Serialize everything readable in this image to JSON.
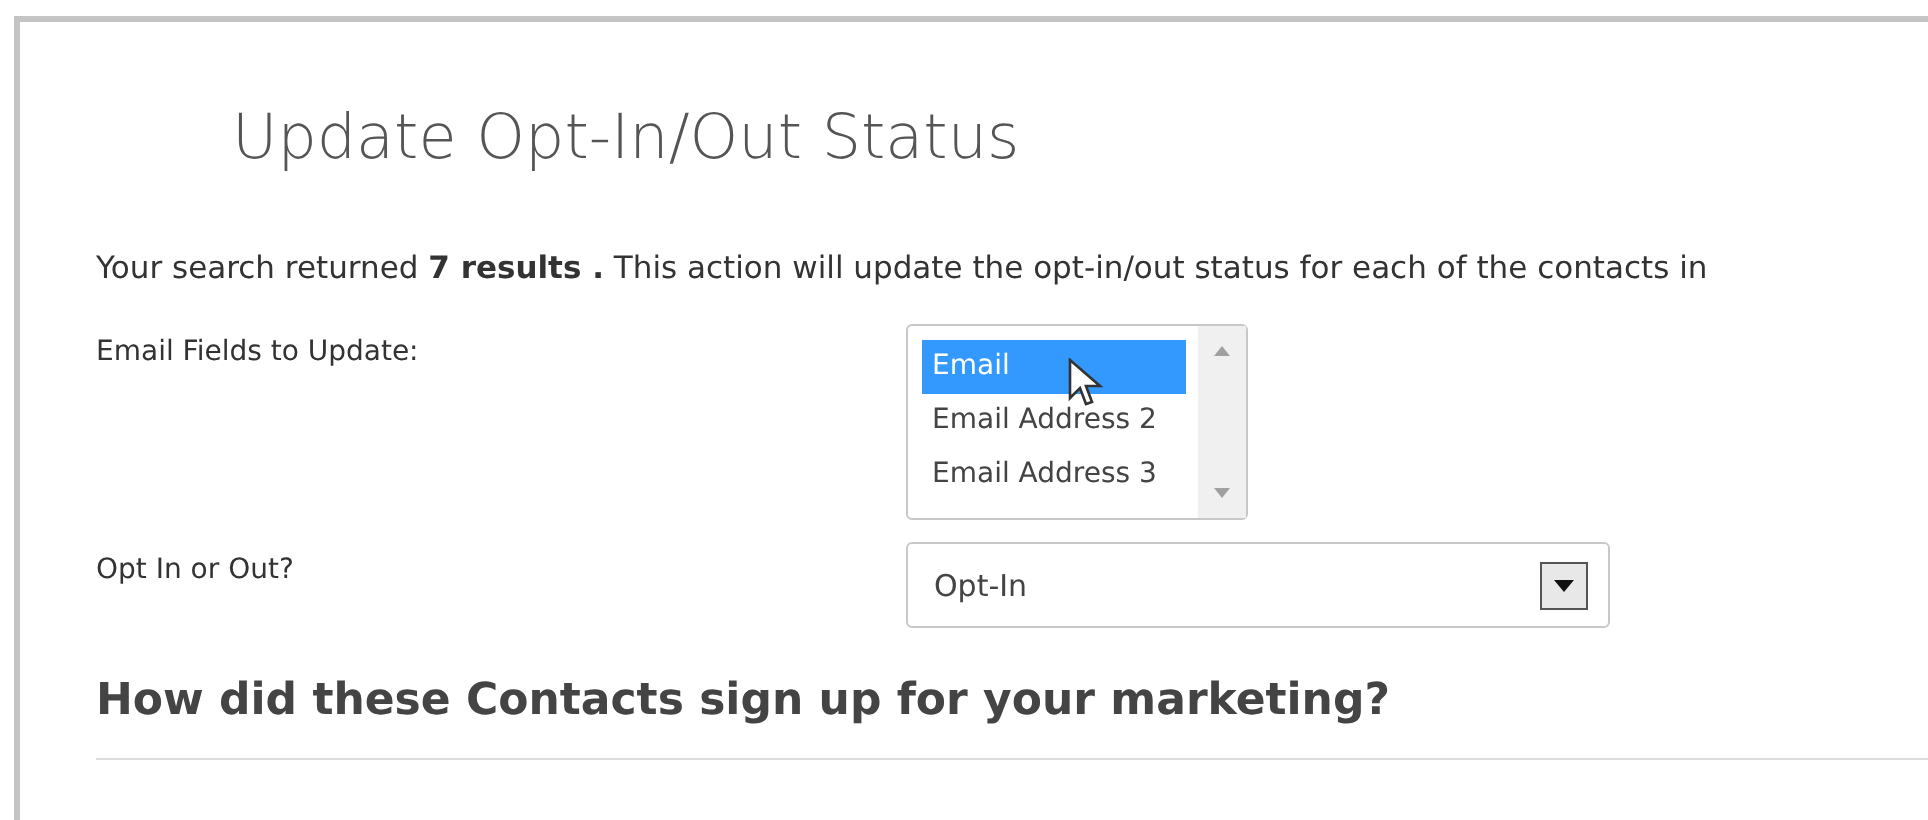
{
  "title": "Update Opt-In/Out Status",
  "intro": "Your search returned **7 results .** This action will update the opt-in/out status for each of the contacts in",
  "fields": [
    {
      "kind": "listbox",
      "label": "Email Fields to Update:",
      "options": [
        {
          "label": "Email",
          "selected": true
        },
        {
          "label": "Email Address 2",
          "selected": false
        },
        {
          "label": "Email Address 3",
          "selected": false
        }
      ]
    },
    {
      "kind": "select",
      "label": "Opt In or Out?",
      "value": "Opt-In"
    }
  ],
  "section_heading": "How did these Contacts sign up for your marketing?"
}
